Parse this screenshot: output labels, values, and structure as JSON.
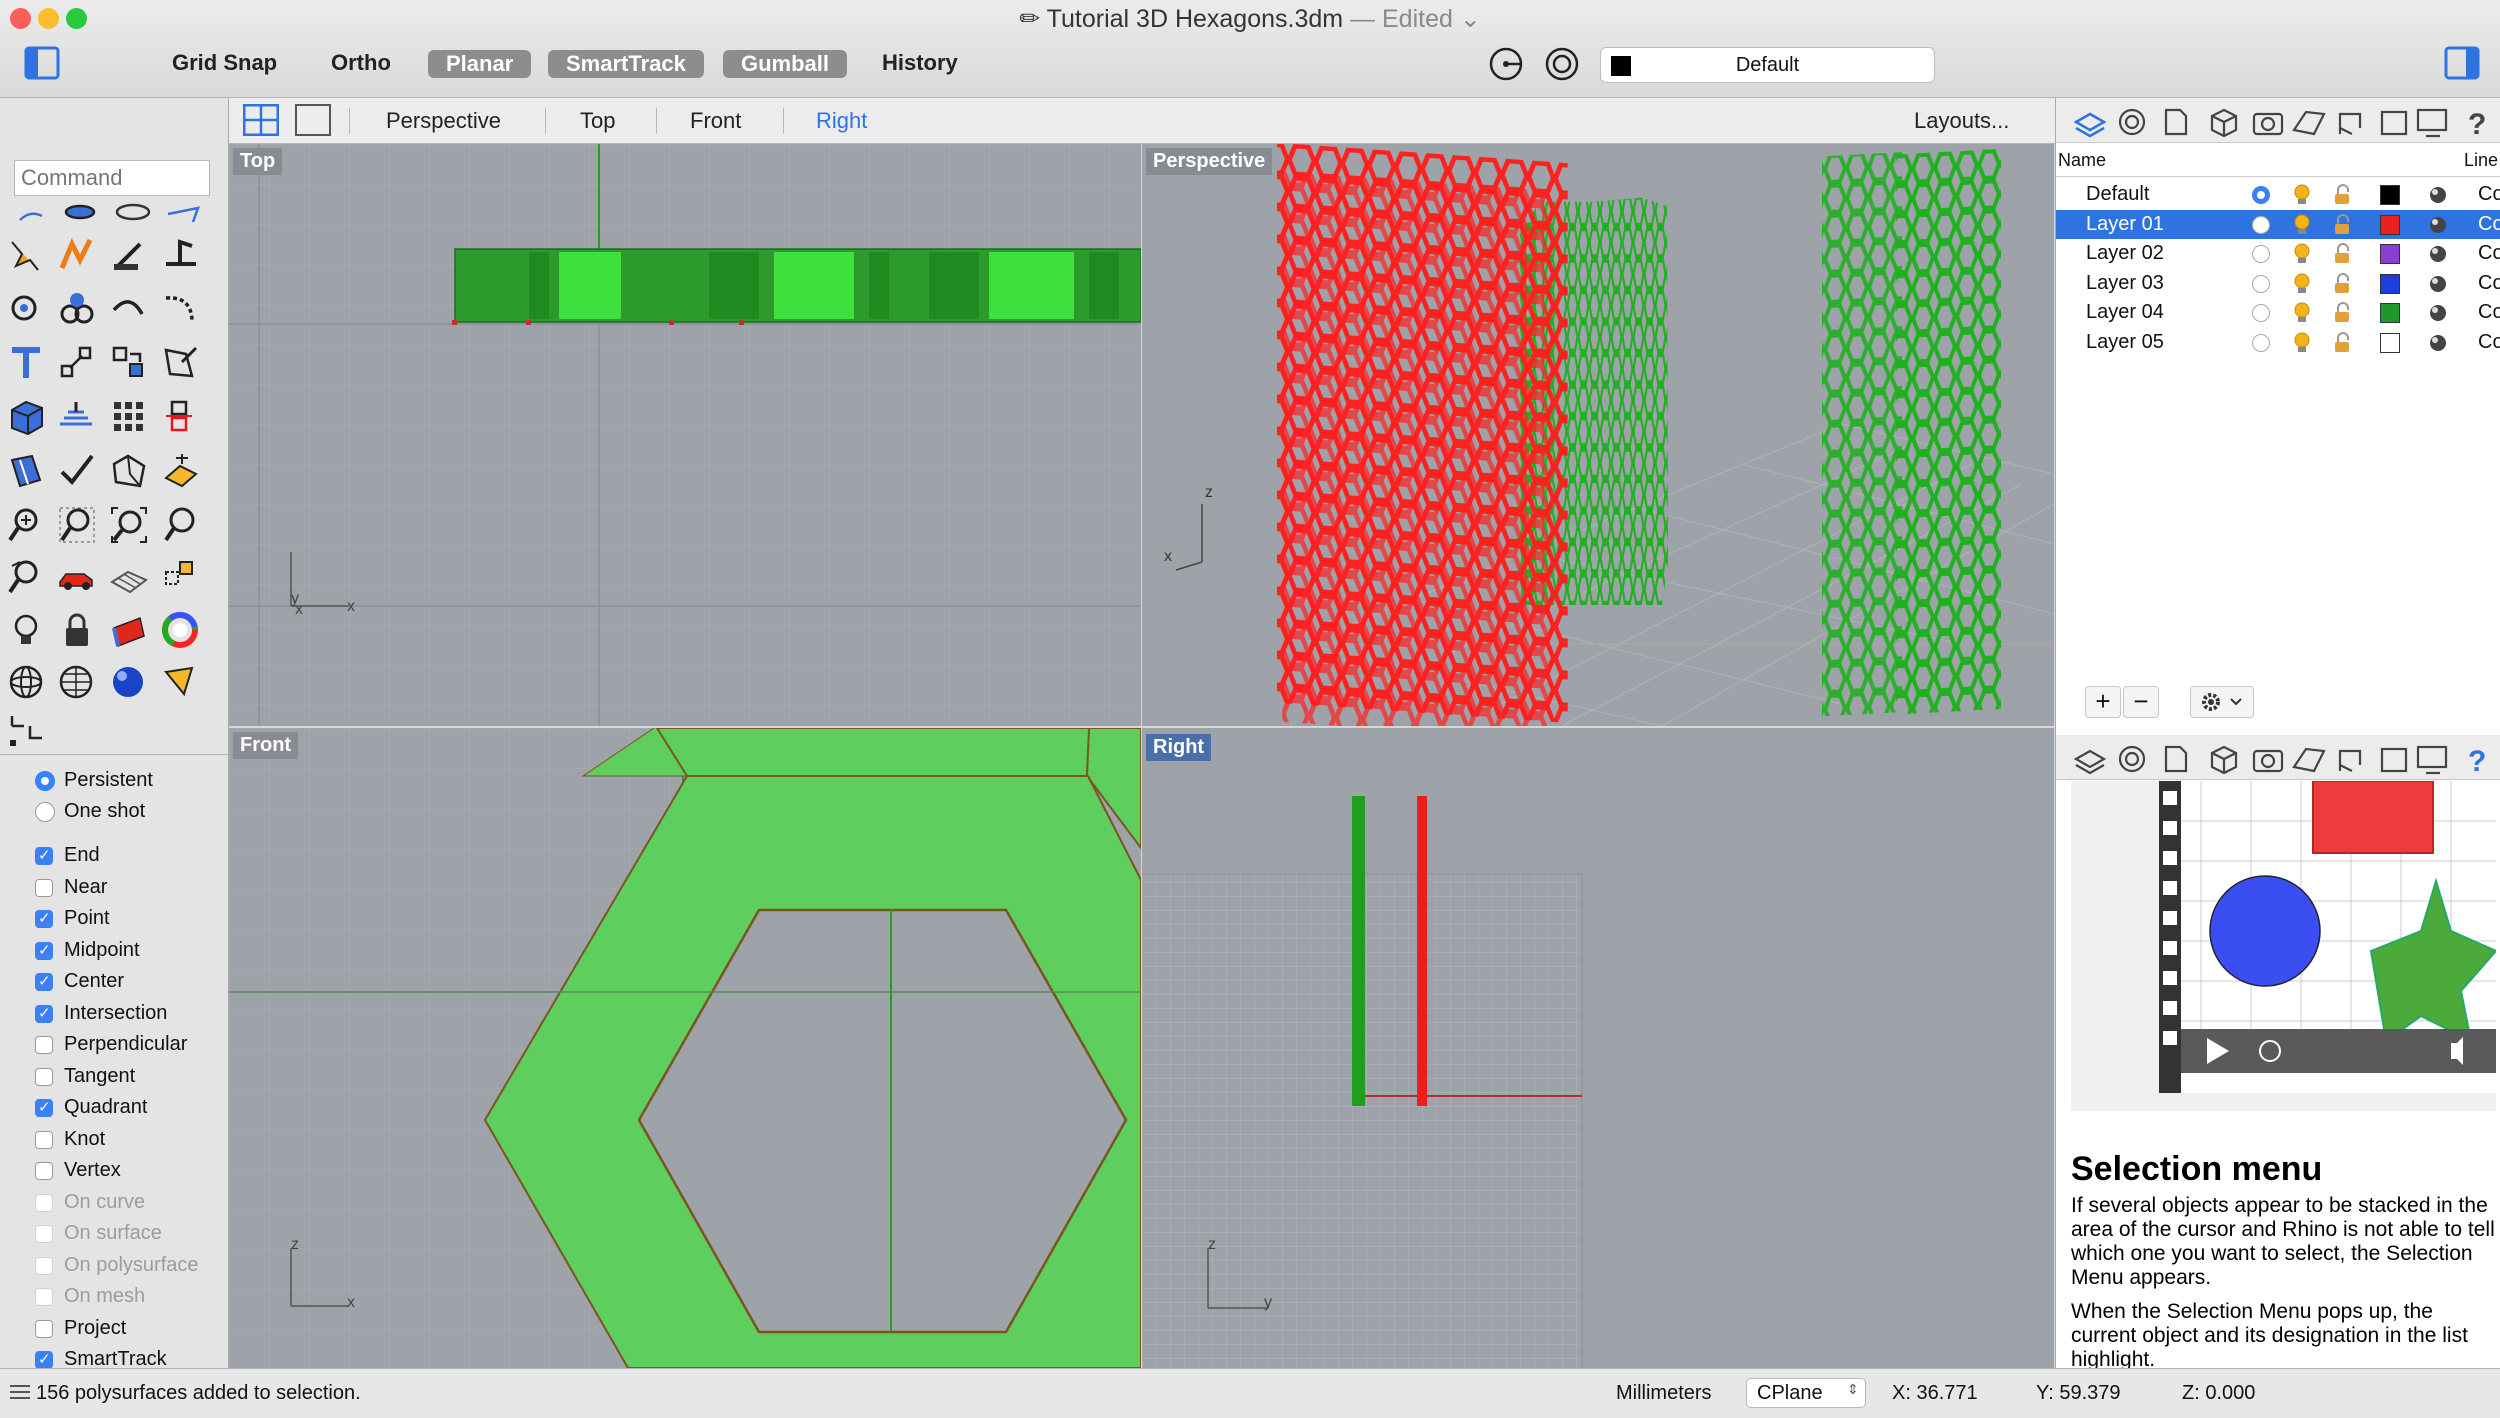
{
  "window": {
    "title": "Tutorial 3D Hexagons.3dm",
    "edited": "— Edited"
  },
  "toolbar": {
    "grid_snap": "Grid Snap",
    "ortho": "Ortho",
    "planar": "Planar",
    "smarttrack": "SmartTrack",
    "gumball": "Gumball",
    "history": "History",
    "layer": "Default",
    "layer_color": "#000000"
  },
  "command": {
    "placeholder": "Command"
  },
  "viewtabs": {
    "perspective": "Perspective",
    "top": "Top",
    "front": "Front",
    "right": "Right",
    "layouts": "Layouts..."
  },
  "viewports": {
    "top": {
      "title": "Top",
      "axis_y": "y",
      "axis_x": "x"
    },
    "perspective": {
      "title": "Perspective",
      "axis_z": "z",
      "axis_x": "x"
    },
    "front": {
      "title": "Front",
      "axis_z": "z",
      "axis_x": "x"
    },
    "right": {
      "title": "Right",
      "axis_z": "z",
      "axis_y": "y"
    }
  },
  "osnap": {
    "persistent": "Persistent",
    "one_shot": "One shot",
    "items": [
      {
        "label": "End",
        "checked": true
      },
      {
        "label": "Near",
        "checked": false
      },
      {
        "label": "Point",
        "checked": true
      },
      {
        "label": "Midpoint",
        "checked": true
      },
      {
        "label": "Center",
        "checked": true
      },
      {
        "label": "Intersection",
        "checked": true
      },
      {
        "label": "Perpendicular",
        "checked": false
      },
      {
        "label": "Tangent",
        "checked": false
      },
      {
        "label": "Quadrant",
        "checked": true
      },
      {
        "label": "Knot",
        "checked": false
      },
      {
        "label": "Vertex",
        "checked": false
      },
      {
        "label": "On curve",
        "checked": false,
        "disabled": true
      },
      {
        "label": "On surface",
        "checked": false,
        "disabled": true
      },
      {
        "label": "On polysurface",
        "checked": false,
        "disabled": true
      },
      {
        "label": "On mesh",
        "checked": false,
        "disabled": true
      },
      {
        "label": "Project",
        "checked": false
      },
      {
        "label": "SmartTrack",
        "checked": true
      }
    ]
  },
  "layers": {
    "col_name": "Name",
    "col_line": "Line",
    "rows": [
      {
        "name": "Default",
        "color": "#000000",
        "current": true,
        "line": "Cor"
      },
      {
        "name": "Layer 01",
        "color": "#e8231c",
        "selected": true,
        "line": "Cor"
      },
      {
        "name": "Layer 02",
        "color": "#8b3fd1",
        "line": "Cor"
      },
      {
        "name": "Layer 03",
        "color": "#1f3ee0",
        "line": "Cor"
      },
      {
        "name": "Layer 04",
        "color": "#1b9a2a",
        "line": "Cor"
      },
      {
        "name": "Layer 05",
        "color": "#ffffff",
        "line": "Cor"
      }
    ],
    "add": "+",
    "remove": "−"
  },
  "help": {
    "heading": "Selection menu",
    "para1": "If several objects appear to be stacked in the area of the cursor and Rhino is not able to tell which one you want to select, the Selection Menu appears.",
    "para2": "When the Selection Menu pops up, the current object and its designation in the list highlight."
  },
  "status": {
    "message": "156 polysurfaces added to selection.",
    "units": "Millimeters",
    "cplane": "CPlane",
    "x": "X: 36.771",
    "y": "Y: 59.379",
    "z": "Z: 0.000"
  },
  "colors": {
    "accent": "#3a80f6",
    "viewport": "#9ea3aa",
    "red": "#ea1d1d",
    "green": "#2fbf2f"
  }
}
